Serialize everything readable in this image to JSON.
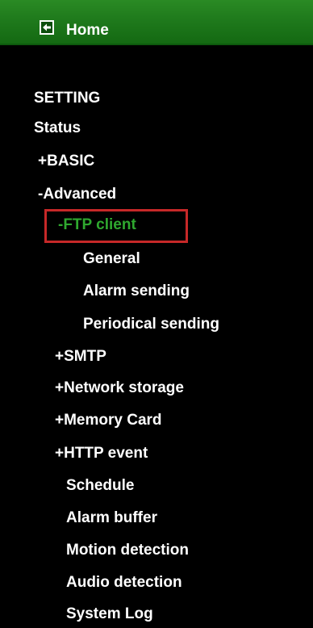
{
  "header": {
    "back_icon": "back-arrow-icon",
    "title": "Home",
    "accent_color": "#1f7a1c"
  },
  "menu": {
    "setting": "SETTING",
    "status": "Status",
    "basic": {
      "prefix": "+",
      "label": "BASIC"
    },
    "advanced": {
      "prefix": "-",
      "label": "Advanced"
    },
    "ftp_client": {
      "prefix": "-",
      "label": "FTP client",
      "active_color": "#2fa82f"
    },
    "ftp_general": "General",
    "ftp_alarm_sending": "Alarm sending",
    "ftp_periodical_sending": "Periodical sending",
    "smtp": {
      "prefix": "+",
      "label": "SMTP"
    },
    "network_storage": {
      "prefix": "+",
      "label": "Network storage"
    },
    "memory_card": {
      "prefix": "+",
      "label": "Memory Card"
    },
    "http_event": {
      "prefix": "+",
      "label": "HTTP event"
    },
    "schedule": "Schedule",
    "alarm_buffer": "Alarm buffer",
    "motion_detection": "Motion detection",
    "audio_detection": "Audio detection",
    "system_log": "System Log"
  }
}
